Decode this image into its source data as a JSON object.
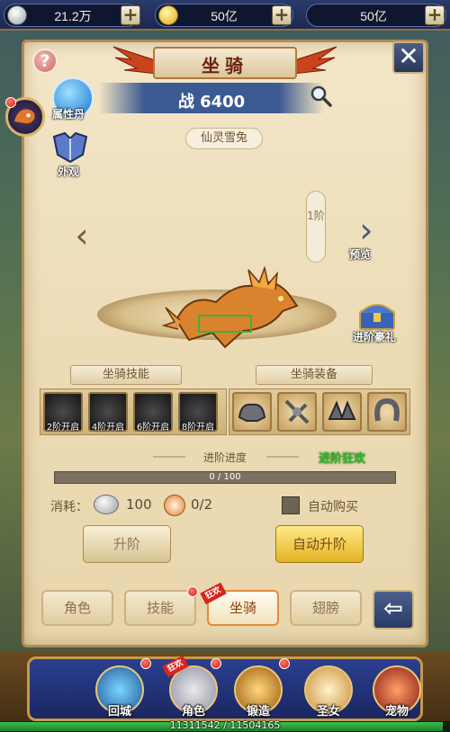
{
  "topbar": {
    "silver_amount": "21.2万",
    "gold_amount": "50亿",
    "diamond_amount": "50亿"
  },
  "window": {
    "title": "坐骑",
    "power": "战 6400",
    "mount_name": "仙灵雪兔"
  },
  "side": {
    "attributes_label": "属性丹",
    "appearance_label": "外观",
    "preview_label": "预览",
    "gift_label": "进阶豪礼",
    "tier_text": "1阶"
  },
  "sections": {
    "skills_title": "坐骑技能",
    "equip_title": "坐骑装备",
    "skills": [
      {
        "caption": "2阶开启"
      },
      {
        "caption": "4阶开启"
      },
      {
        "caption": "6阶开启"
      },
      {
        "caption": "8阶开启"
      }
    ]
  },
  "progress": {
    "label": "进阶进度",
    "celebrate": "进阶狂欢",
    "text": "0 / 100",
    "fraction": 0
  },
  "cost": {
    "label": "消耗：",
    "silver": "100",
    "pill": "0/2",
    "auto_buy": "自动购买"
  },
  "buttons": {
    "upgrade": "升阶",
    "auto_upgrade": "自动升阶"
  },
  "tabs": [
    {
      "label": "角色"
    },
    {
      "label": "技能"
    },
    {
      "label": "坐骑"
    },
    {
      "label": "翅膀"
    }
  ],
  "fire_tag": "狂欢",
  "bottom_nav": [
    {
      "label": "回城"
    },
    {
      "label": "角色"
    },
    {
      "label": "锻造"
    },
    {
      "label": "圣女"
    },
    {
      "label": "宠物"
    }
  ],
  "xp": {
    "text": "11311542 / 11504165",
    "fraction": 0.983
  },
  "colors": {
    "panel_bg": "#f3e6c8",
    "accent_gold": "#e3b423",
    "title_red": "#6a2410",
    "celebrate_green": "#2fba2a"
  }
}
